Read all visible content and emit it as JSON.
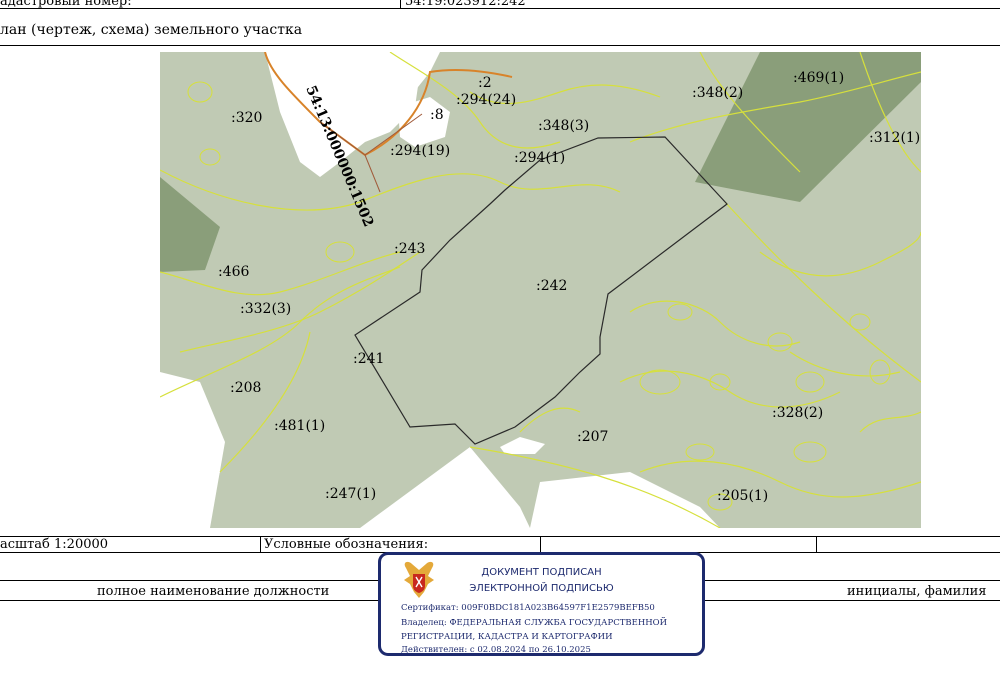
{
  "header": {
    "cadastral_label": "адастровый номер:",
    "cadastral_value": "54:19:023912:242",
    "plan_title": "лан (чертеж, схема) земельного участка"
  },
  "map": {
    "road_label": "54:13:000000:1502",
    "parcel_labels": [
      ":2",
      ":294(24)",
      ":348(2)",
      ":469(1)",
      ":8",
      ":320",
      ":348(3)",
      ":312(1)",
      ":294(19)",
      ":294(1)",
      ":243",
      ":466",
      ":242",
      ":332(3)",
      ":241",
      ":208",
      ":328(2)",
      ":481(1)",
      ":207",
      ":247(1)",
      ":205(1)"
    ],
    "colors": {
      "land": "#c0cab4",
      "forest": "#8a9e7a",
      "boundary": "#d6e03c",
      "road": "#d8832a",
      "parcel": "#2a2a2a"
    }
  },
  "footer": {
    "scale": "асштаб 1:20000",
    "legend": "Условные обозначения:",
    "position": "полное наименование должности",
    "initials": "инициалы, фамилия"
  },
  "stamp": {
    "title_1": "ДОКУМЕНТ ПОДПИСАН",
    "title_2": "ЭЛЕКТРОННОЙ ПОДПИСЬЮ",
    "certificate": "Сертификат: 009F0BDC181A023B64597F1E2579BEFB50",
    "owner_1": "Владелец: ФЕДЕРАЛЬНАЯ СЛУЖБА ГОСУДАРСТВЕННОЙ",
    "owner_2": "РЕГИСТРАЦИИ, КАДАСТРА И КАРТОГРАФИИ",
    "validity": "Действителен: с 02.08.2024 по 26.10.2025"
  }
}
